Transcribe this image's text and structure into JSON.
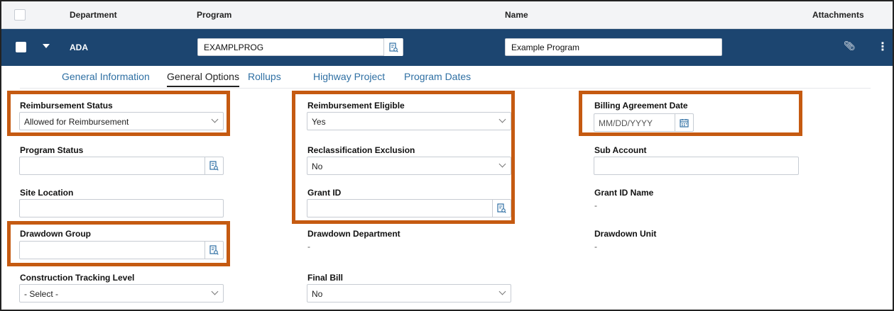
{
  "header": {
    "columns": [
      "Department",
      "Program",
      "Name",
      "Attachments"
    ]
  },
  "row": {
    "department": "ADA",
    "program_value": "EXAMPLPROG",
    "name_value": "Example Program"
  },
  "tabs": [
    {
      "label": "General Information",
      "active": false
    },
    {
      "label": "General Options",
      "active": true
    },
    {
      "label": "Rollups",
      "active": false
    },
    {
      "label": "Highway Project",
      "active": false
    },
    {
      "label": "Program Dates",
      "active": false
    }
  ],
  "fields": {
    "reimbursement_status": {
      "label": "Reimbursement Status",
      "value": "Allowed for Reimbursement"
    },
    "reimbursement_eligible": {
      "label": "Reimbursement Eligible",
      "value": "Yes"
    },
    "billing_agreement_date": {
      "label": "Billing Agreement Date",
      "placeholder": "MM/DD/YYYY"
    },
    "program_status": {
      "label": "Program Status",
      "value": ""
    },
    "reclassification_exclusion": {
      "label": "Reclassification Exclusion",
      "value": "No"
    },
    "sub_account": {
      "label": "Sub Account",
      "value": ""
    },
    "site_location": {
      "label": "Site Location",
      "value": ""
    },
    "grant_id": {
      "label": "Grant ID",
      "value": ""
    },
    "grant_id_name": {
      "label": "Grant ID Name",
      "value": "-"
    },
    "drawdown_group": {
      "label": "Drawdown Group",
      "value": ""
    },
    "drawdown_department": {
      "label": "Drawdown Department",
      "value": "-"
    },
    "drawdown_unit": {
      "label": "Drawdown Unit",
      "value": "-"
    },
    "construction_tracking_level": {
      "label": "Construction Tracking Level",
      "value": "- Select -"
    },
    "final_bill": {
      "label": "Final Bill",
      "value": "No"
    }
  },
  "colors": {
    "row_bg": "#1c4570",
    "highlight": "#c55a11",
    "tab_link": "#2e6fa3"
  }
}
